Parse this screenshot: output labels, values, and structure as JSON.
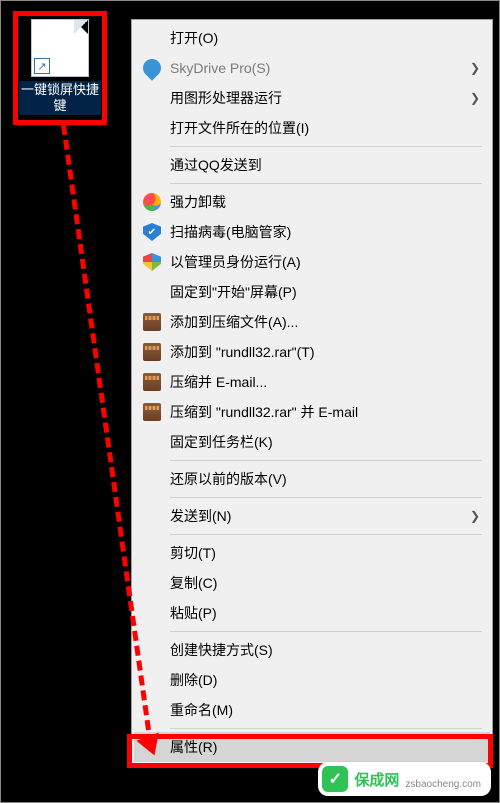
{
  "desktop_icon": {
    "label": "一键锁屏快捷键",
    "shortcut_glyph": "↗"
  },
  "menu": {
    "items": [
      {
        "label": "打开(O)",
        "icon": "",
        "hasArrow": false
      },
      {
        "label": "SkyDrive Pro(S)",
        "icon": "sky",
        "hasArrow": true,
        "disabled": true
      },
      {
        "label": "用图形处理器运行",
        "icon": "",
        "hasArrow": true
      },
      {
        "label": "打开文件所在的位置(I)",
        "icon": "",
        "hasArrow": false
      }
    ],
    "group2": [
      {
        "label": "通过QQ发送到",
        "icon": "",
        "hasArrow": false
      }
    ],
    "group3": [
      {
        "label": "强力卸载",
        "icon": "flower",
        "hasArrow": false
      },
      {
        "label": "扫描病毒(电脑管家)",
        "icon": "shield-blue",
        "hasArrow": false
      },
      {
        "label": "以管理员身份运行(A)",
        "icon": "shield-ms",
        "hasArrow": false
      },
      {
        "label": "固定到\"开始\"屏幕(P)",
        "icon": "",
        "hasArrow": false
      },
      {
        "label": "添加到压缩文件(A)...",
        "icon": "rar",
        "hasArrow": false
      },
      {
        "label": "添加到 \"rundll32.rar\"(T)",
        "icon": "rar",
        "hasArrow": false
      },
      {
        "label": "压缩并 E-mail...",
        "icon": "rar",
        "hasArrow": false
      },
      {
        "label": "压缩到 \"rundll32.rar\" 并 E-mail",
        "icon": "rar",
        "hasArrow": false
      },
      {
        "label": "固定到任务栏(K)",
        "icon": "",
        "hasArrow": false
      }
    ],
    "group4": [
      {
        "label": "还原以前的版本(V)",
        "icon": "",
        "hasArrow": false
      }
    ],
    "group5": [
      {
        "label": "发送到(N)",
        "icon": "",
        "hasArrow": true
      }
    ],
    "group6": [
      {
        "label": "剪切(T)",
        "icon": "",
        "hasArrow": false
      },
      {
        "label": "复制(C)",
        "icon": "",
        "hasArrow": false
      },
      {
        "label": "粘贴(P)",
        "icon": "",
        "hasArrow": false
      }
    ],
    "group7": [
      {
        "label": "创建快捷方式(S)",
        "icon": "",
        "hasArrow": false
      },
      {
        "label": "删除(D)",
        "icon": "",
        "hasArrow": false
      },
      {
        "label": "重命名(M)",
        "icon": "",
        "hasArrow": false
      }
    ],
    "group8": [
      {
        "label": "属性(R)",
        "icon": "",
        "hasArrow": false,
        "highlight": true
      }
    ]
  },
  "watermark": {
    "icon_glyph": "✓",
    "text": "保成网",
    "sub": "zsbaocheng.com"
  }
}
